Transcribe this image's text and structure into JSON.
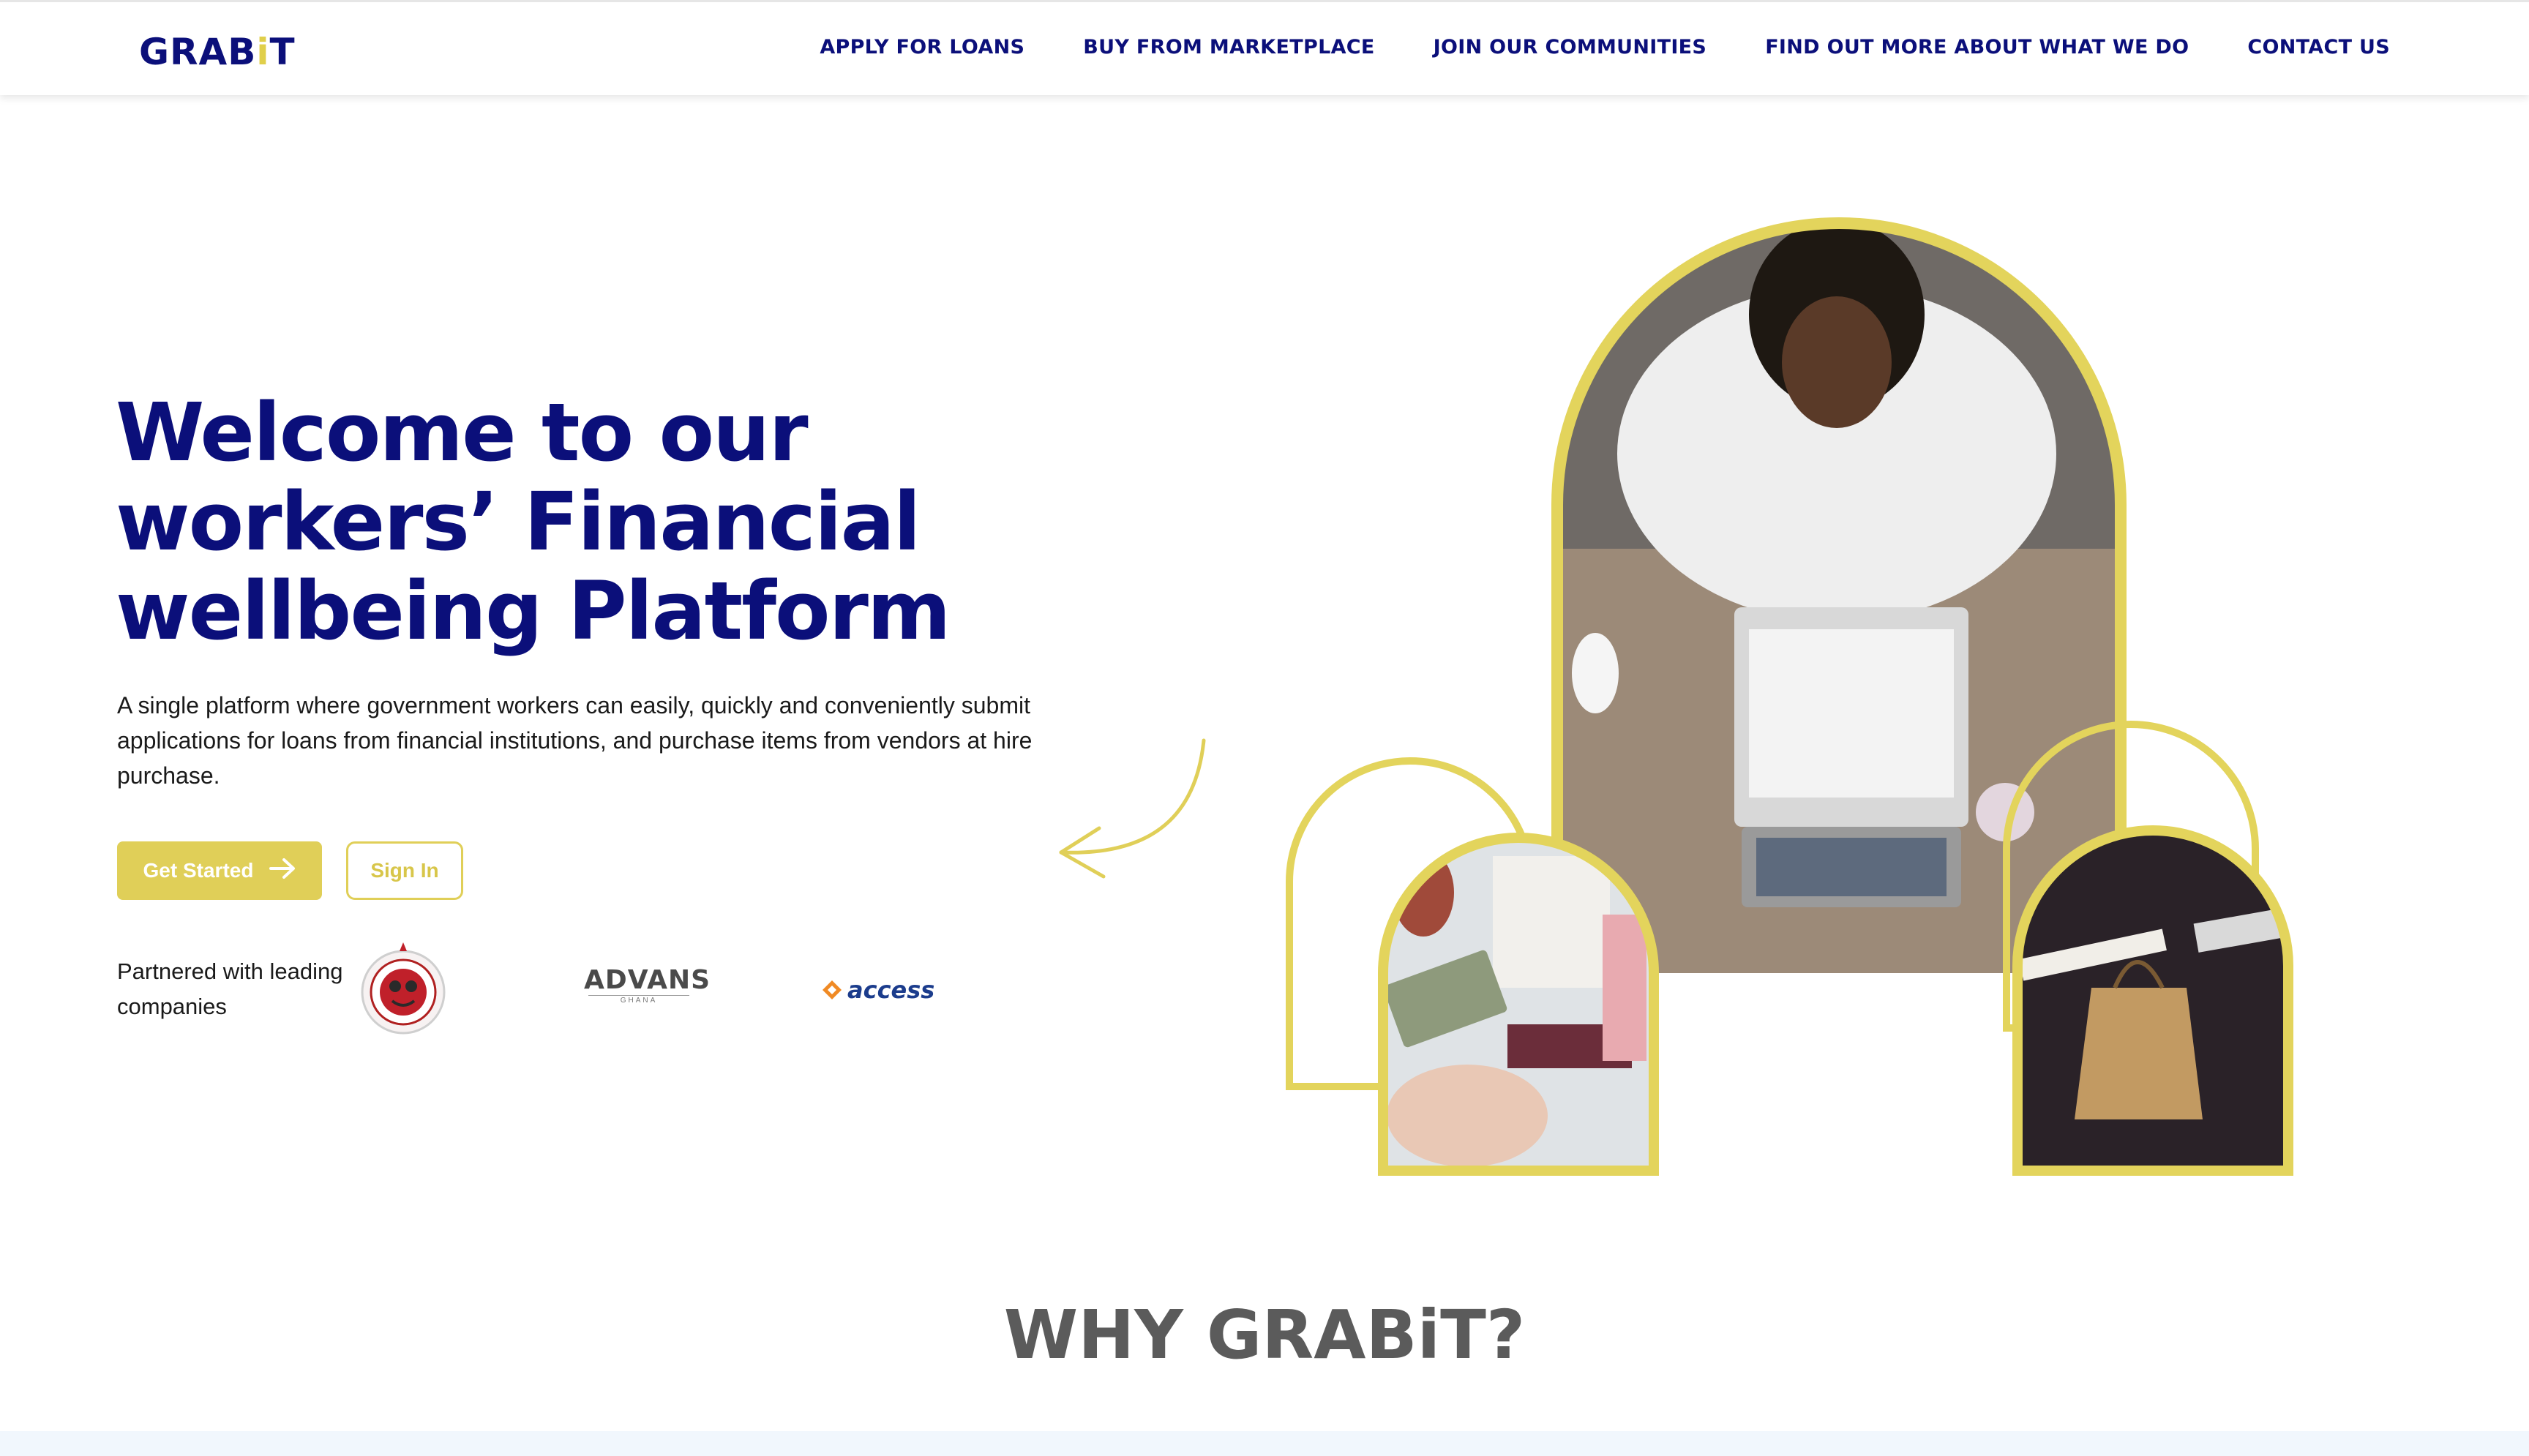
{
  "header": {
    "logo": {
      "prefix": "GRAB",
      "i": "i",
      "suffix": "T"
    },
    "nav": [
      {
        "label": "APPLY FOR LOANS"
      },
      {
        "label": "BUY FROM MARKETPLACE"
      },
      {
        "label": "JOIN OUR COMMUNITIES"
      },
      {
        "label": "FIND OUT MORE ABOUT WHAT WE DO"
      },
      {
        "label": "CONTACT US"
      }
    ]
  },
  "hero": {
    "title": "Welcome to our workers’ Financial wellbeing Platform",
    "description": "A single platform where government workers can easily, quickly and conveniently submit applications for loans from financial institutions, and purchase items from vendors at hire purchase.",
    "primary_button": {
      "label": "Get Started",
      "icon": "arrow-right-icon"
    },
    "secondary_button": {
      "label": "Sign In"
    }
  },
  "partners": {
    "label": "Partnered with leading companies",
    "logos": [
      {
        "name": "seal-logo"
      },
      {
        "name": "ADVANS",
        "sub": "GHANA"
      },
      {
        "name": "access"
      }
    ]
  },
  "why": {
    "title": "WHY GRABiT?"
  },
  "colors": {
    "brand_navy": "#0b0f7a",
    "accent_yellow": "#e0cf58",
    "heading_gray": "#5b5b5b"
  }
}
